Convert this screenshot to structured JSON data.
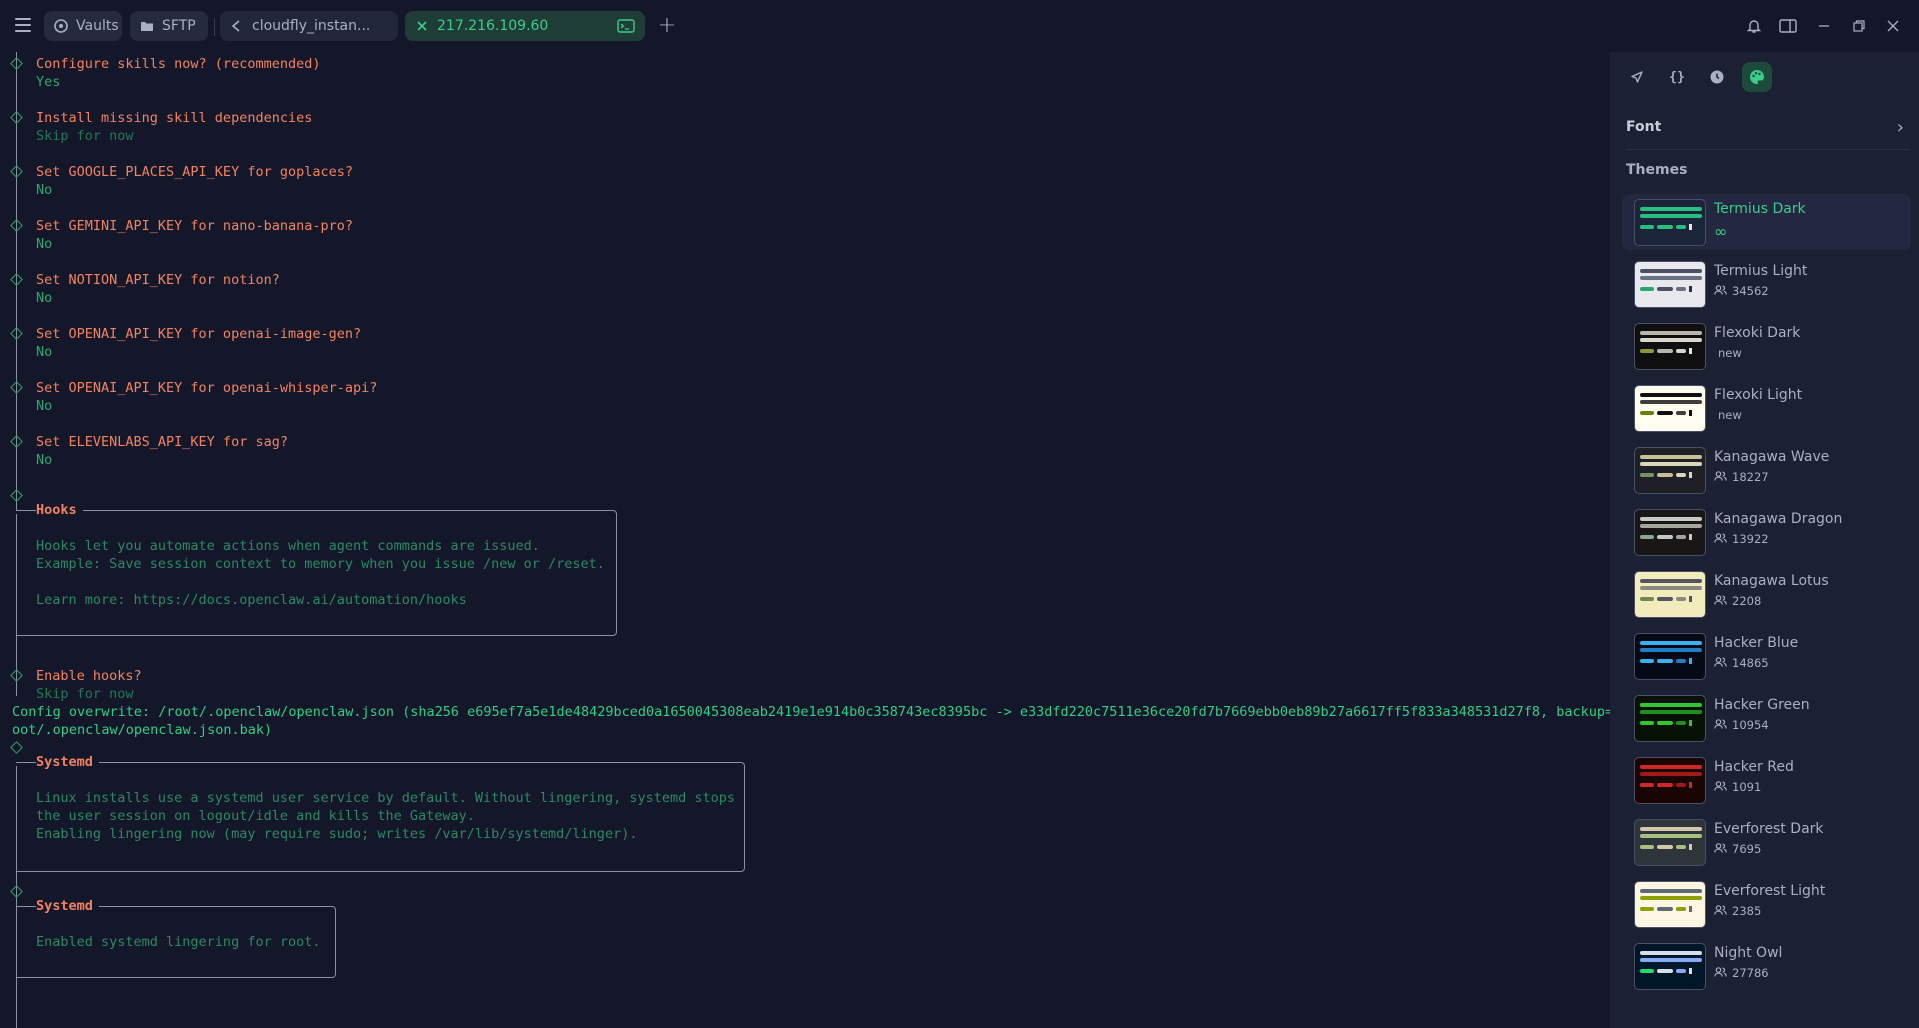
{
  "topbar": {
    "vaults_label": "Vaults",
    "sftp_label": "SFTP",
    "tab1_label": "cloudfly_instan...",
    "tab2_label": "217.216.109.60"
  },
  "terminal": {
    "prompts": [
      {
        "q": "Configure skills now? (recommended)",
        "a": "Yes",
        "dim": false
      },
      {
        "q": "Install missing skill dependencies",
        "a": "Skip for now",
        "dim": true
      },
      {
        "q": "Set GOOGLE_PLACES_API_KEY for goplaces?",
        "a": "No",
        "dim": false
      },
      {
        "q": "Set GEMINI_API_KEY for nano-banana-pro?",
        "a": "No",
        "dim": false
      },
      {
        "q": "Set NOTION_API_KEY for notion?",
        "a": "No",
        "dim": false
      },
      {
        "q": "Set OPENAI_API_KEY for openai-image-gen?",
        "a": "No",
        "dim": false
      },
      {
        "q": "Set OPENAI_API_KEY for openai-whisper-api?",
        "a": "No",
        "dim": false
      },
      {
        "q": "Set ELEVENLABS_API_KEY for sag?",
        "a": "No",
        "dim": false
      }
    ],
    "hooks_box": {
      "title": "Hooks",
      "lines": [
        "Hooks let you automate actions when agent commands are issued.",
        "Example: Save session context to memory when you issue /new or /reset.",
        "",
        "Learn more: https://docs.openclaw.ai/automation/hooks"
      ]
    },
    "enable_hooks": {
      "q": "Enable hooks?",
      "a": "Skip for now"
    },
    "config_overwrite": [
      "Config overwrite: /root/.openclaw/openclaw.json (sha256 e695ef7a5e1de48429bced0a1650045308eab2419e1e914b0c358743ec8395bc -> e33dfd220c7511e36ce20fd7b7669ebb0eb89b27a6617ff5f833a348531d27f8, backup=/r",
      "oot/.openclaw/openclaw.json.bak)"
    ],
    "systemd_box1": {
      "title": "Systemd",
      "lines": [
        "Linux installs use a systemd user service by default. Without lingering, systemd stops",
        "the user session on logout/idle and kills the Gateway.",
        "Enabling lingering now (may require sudo; writes /var/lib/systemd/linger)."
      ]
    },
    "systemd_box2": {
      "title": "Systemd",
      "lines": [
        "Enabled systemd lingering for root."
      ]
    }
  },
  "sidebar": {
    "font_label": "Font",
    "themes_title": "Themes",
    "themes": [
      {
        "name": "Termius Dark",
        "meta": "∞",
        "kind": "infinity",
        "colors": {
          "bg": "#1b2438",
          "a": "#27c07d",
          "b": "#27c07d",
          "c": "#27c07d",
          "d": "#e6e6e6"
        }
      },
      {
        "name": "Termius Light",
        "meta": "34562",
        "kind": "users",
        "colors": {
          "bg": "#e7e9ee",
          "a": "#4b5063",
          "b": "#6b7083",
          "c": "#27a86f",
          "d": "#2a2e3f"
        }
      },
      {
        "name": "Flexoki Dark",
        "meta": "new",
        "kind": "new",
        "colors": {
          "bg": "#100f0f",
          "a": "#b7b5ac",
          "b": "#d8d6cd",
          "c": "#879a39",
          "d": "#e6e4d9"
        }
      },
      {
        "name": "Flexoki Light",
        "meta": "new",
        "kind": "new",
        "colors": {
          "bg": "#fffcf0",
          "a": "#100f0f",
          "b": "#403e3c",
          "c": "#66800b",
          "d": "#100f0f"
        }
      },
      {
        "name": "Kanagawa Wave",
        "meta": "18227",
        "kind": "users",
        "colors": {
          "bg": "#1f1f28",
          "a": "#c8c093",
          "b": "#dcd7ba",
          "c": "#76946a",
          "d": "#dcd7ba"
        }
      },
      {
        "name": "Kanagawa Dragon",
        "meta": "13922",
        "kind": "users",
        "colors": {
          "bg": "#181616",
          "a": "#c5c9c5",
          "b": "#a6a69c",
          "c": "#87a987",
          "d": "#c5c9c5"
        }
      },
      {
        "name": "Kanagawa Lotus",
        "meta": "2208",
        "kind": "users",
        "colors": {
          "bg": "#f2ecbc",
          "a": "#545464",
          "b": "#8a8980",
          "c": "#6f894e",
          "d": "#545464"
        }
      },
      {
        "name": "Hacker Blue",
        "meta": "14865",
        "kind": "users",
        "colors": {
          "bg": "#060a16",
          "a": "#3ab0f0",
          "b": "#1f7fc0",
          "c": "#3ab0f0",
          "d": "#3ab0f0"
        }
      },
      {
        "name": "Hacker Green",
        "meta": "10954",
        "kind": "users",
        "colors": {
          "bg": "#061206",
          "a": "#34c534",
          "b": "#1f8f1f",
          "c": "#34c534",
          "d": "#34c534"
        }
      },
      {
        "name": "Hacker Red",
        "meta": "1091",
        "kind": "users",
        "colors": {
          "bg": "#1a0505",
          "a": "#d02828",
          "b": "#a01818",
          "c": "#d02828",
          "d": "#d02828"
        }
      },
      {
        "name": "Everforest Dark",
        "meta": "7695",
        "kind": "users",
        "colors": {
          "bg": "#2d353b",
          "a": "#d3c6aa",
          "b": "#a7c080",
          "c": "#a7c080",
          "d": "#d3c6aa"
        }
      },
      {
        "name": "Everforest Light",
        "meta": "2385",
        "kind": "users",
        "colors": {
          "bg": "#fdf6e3",
          "a": "#5c6a72",
          "b": "#8da101",
          "c": "#8da101",
          "d": "#5c6a72"
        }
      },
      {
        "name": "Night Owl",
        "meta": "27786",
        "kind": "users",
        "colors": {
          "bg": "#011627",
          "a": "#d6deeb",
          "b": "#82aaff",
          "c": "#22da6e",
          "d": "#d6deeb"
        }
      }
    ]
  }
}
